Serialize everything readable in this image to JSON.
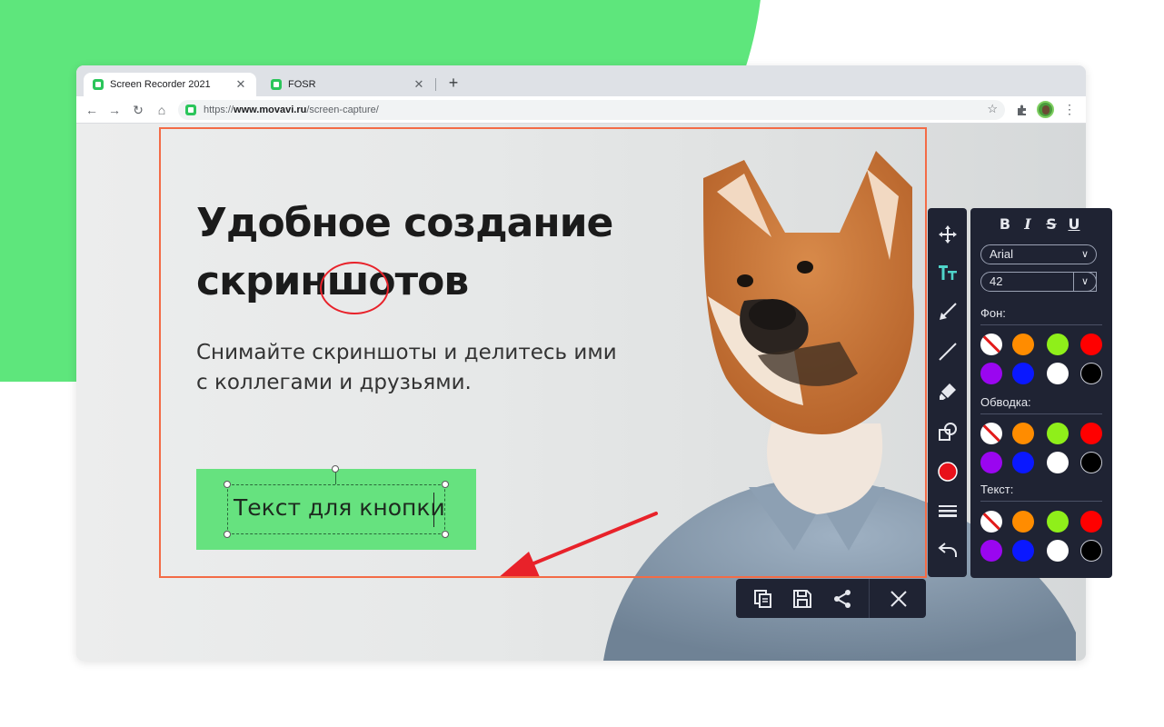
{
  "browser": {
    "tabs": [
      {
        "title": "Screen Recorder 2021",
        "active": true
      },
      {
        "title": "FOSR",
        "active": false
      }
    ],
    "new_tab_symbol": "+",
    "tab_close_symbol": "✕",
    "url": {
      "scheme": "https://",
      "host": "www.movavi.ru",
      "path": "/screen-capture/"
    },
    "nav": {
      "back": "←",
      "forward": "→",
      "reload": "↻",
      "home": "⌂",
      "star": "☆",
      "menu": "⋮"
    }
  },
  "page": {
    "headline": "Удобное создание скриншотов",
    "subtitle": "Снимайте скриншоты и делитесь ими с коллегами и друзьями.",
    "button_text": "Текст для кнопки"
  },
  "tools": [
    {
      "name": "move-icon"
    },
    {
      "name": "text-tool-icon",
      "active": true
    },
    {
      "name": "arrow-tool-icon"
    },
    {
      "name": "line-tool-icon"
    },
    {
      "name": "marker-icon"
    },
    {
      "name": "shapes-icon"
    },
    {
      "name": "color-picker-icon",
      "color": "#e8111a"
    },
    {
      "name": "line-width-icon"
    },
    {
      "name": "undo-icon"
    }
  ],
  "text_panel": {
    "format": {
      "bold": "B",
      "italic": "I",
      "strike": "S",
      "underline": "U"
    },
    "font": "Arial",
    "size": "42",
    "background_label": "Фон:",
    "stroke_label": "Обводка:",
    "text_label": "Текст:",
    "palette": [
      "none",
      "#ff8c00",
      "#8fef1a",
      "#ff0000",
      "#9a06f0",
      "#0a18ff",
      "#ffffff",
      "#000000"
    ],
    "accent": "#4fd4c9"
  },
  "bottom_actions": [
    {
      "name": "copy-icon"
    },
    {
      "name": "save-icon"
    },
    {
      "name": "share-icon"
    },
    {
      "name": "close-icon"
    }
  ],
  "colors": {
    "selection": "#f36b46",
    "highlight_ellipse": "#e8222a",
    "cta_bg": "#66e27f",
    "annotation_arrow": "#e8222a",
    "brand_green": "#5ee67c"
  }
}
